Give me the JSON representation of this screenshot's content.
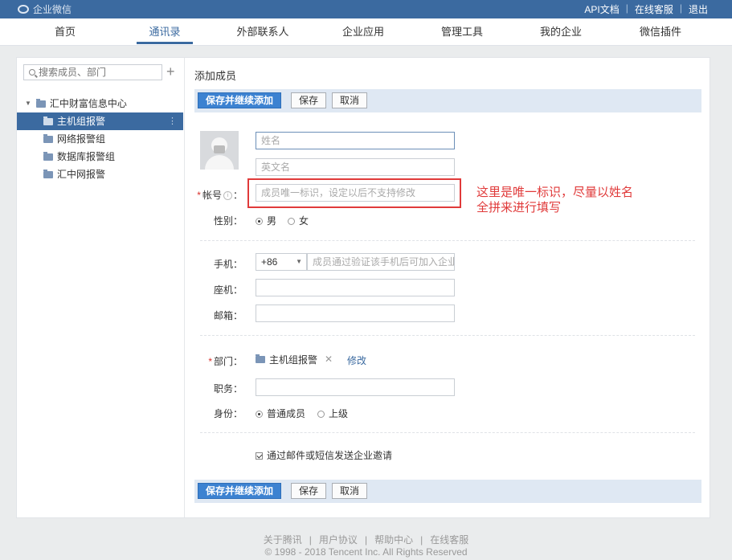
{
  "app": {
    "logo_text": "企业微信"
  },
  "top_links": [
    "API文档",
    "在线客服",
    "退出"
  ],
  "nav": {
    "tabs": [
      "首页",
      "通讯录",
      "外部联系人",
      "企业应用",
      "管理工具",
      "我的企业",
      "微信插件"
    ],
    "active": "通讯录"
  },
  "sidebar": {
    "search_placeholder": "搜索成员、部门",
    "root": "汇中财富信息中心",
    "items": [
      "主机组报警",
      "网络报警组",
      "数据库报警组",
      "汇中网报警"
    ],
    "selected": "主机组报警"
  },
  "form": {
    "title": "添加成员",
    "buttons": {
      "save_continue": "保存并继续添加",
      "save": "保存",
      "cancel": "取消"
    },
    "name_placeholder": "姓名",
    "english_name_placeholder": "英文名",
    "account_label": "帐号",
    "account_placeholder": "成员唯一标识，设定以后不支持修改",
    "gender_label": "性别：",
    "gender_options": [
      "男",
      "女"
    ],
    "gender_selected": "男",
    "mobile_label": "手机：",
    "country_code": "+86",
    "mobile_placeholder": "成员通过验证该手机后可加入企业",
    "landline_label": "座机：",
    "email_label": "邮箱：",
    "department_label": "部门：",
    "department_value": "主机组报警",
    "modify_label": "修改",
    "position_label": "职务：",
    "identity_label": "身份：",
    "identity_options": [
      "普通成员",
      "上级"
    ],
    "identity_selected": "普通成员",
    "invite_label": "通过邮件或短信发送企业邀请",
    "invite_checked": true
  },
  "annotation": {
    "line1": "这里是唯一标识，尽量以姓名",
    "line2": "全拼来进行填写",
    "color": "#e03a3a"
  },
  "footer": {
    "links": [
      "关于腾讯",
      "用户协议",
      "帮助中心",
      "在线客服"
    ],
    "copyright": "© 1998 - 2018 Tencent Inc. All Rights Reserved"
  },
  "colors": {
    "brand": "#3b6aa0",
    "primary_button": "#3c82d1"
  }
}
